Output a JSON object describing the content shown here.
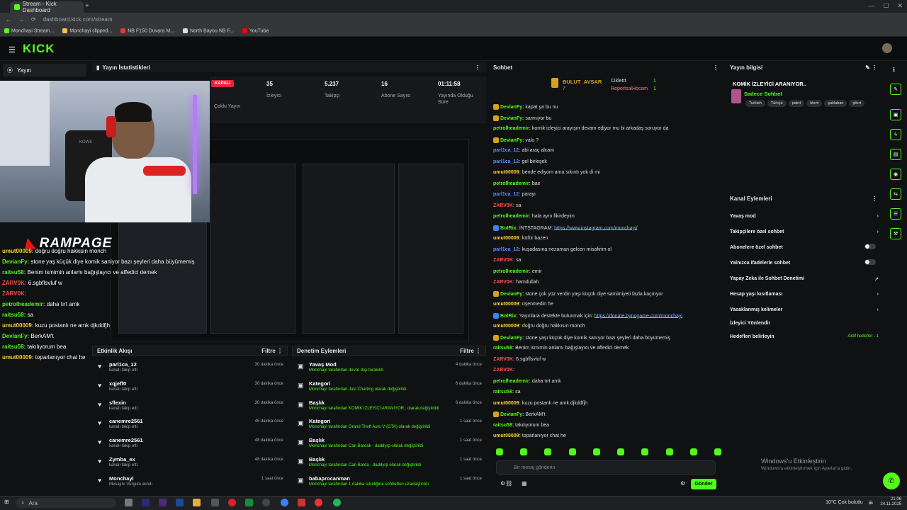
{
  "browser": {
    "tab_title": "Stream - Kick Dashboard",
    "url": "dashboard.kick.com/stream",
    "bookmarks": [
      "Monchayi Stream...",
      "Monchayi clipped...",
      "NB F150 Duvara M...",
      "North Bayou NB F...",
      "YouTube"
    ]
  },
  "brand": {
    "logo": "KICK",
    "accent": "#53fc18"
  },
  "nav": {
    "home": "Yayın"
  },
  "overlay": {
    "sponsor": "RAMPAGE",
    "chat": [
      {
        "user": "umut00009:",
        "text": " doğru doğru hakkisin monch"
      },
      {
        "user": "DevianFy:",
        "text": " stone yaş küçük diye komik saniyor bazı şeyleri daha büyümemiş"
      },
      {
        "user": "raitsu58:",
        "text": " Benim ismimin anlamı bağışlayıcı ve affedici demek"
      },
      {
        "user": "ZARV0K:",
        "text": " 6.sgbflsvluf w"
      },
      {
        "user": "ZARV0K:",
        "text": ""
      },
      {
        "user": "petrolheademir:",
        "text": " daha tırt amk"
      },
      {
        "user": "raitsu58:",
        "text": " sa"
      },
      {
        "user": "umut00009:",
        "text": " kuzu postanlı ne amk djkddfjh"
      },
      {
        "user": "DevianFy:",
        "text": " BerkAM't"
      },
      {
        "user": "raitsu58:",
        "text": " takılıyorum bea"
      },
      {
        "user": "umut00009:",
        "text": " toparlanıyor chat he"
      }
    ]
  },
  "stats": {
    "title": "Yayın İstatistikleri",
    "status": "KAPALI",
    "multi": "Çoklu Yayın",
    "viewers": "35",
    "viewers_label": "İzleyici",
    "followers": "5.237",
    "followers_label": "Takipçi",
    "subs": "16",
    "subs_label": "Abone Sayısı",
    "uptime": "01:11:58",
    "uptime_label": "Yayında Olduğu Süre"
  },
  "activity": {
    "title": "Etkinlik Akışı",
    "filter": "Filtre",
    "rows": [
      {
        "name": "parl1ca_12",
        "sub": "kanalı takip etti",
        "time": "30 dakika önce"
      },
      {
        "name": "xqjeff0",
        "sub": "kanalı takip etti",
        "time": "30 dakika önce"
      },
      {
        "name": "sflexin",
        "sub": "kanalı takip etti",
        "time": "30 dakika önce"
      },
      {
        "name": "canemre2561",
        "sub": "kanalı takip etti",
        "time": "45 dakika önce"
      },
      {
        "name": "canemre2561",
        "sub": "kanalı takip etti",
        "time": "48 dakika önce"
      },
      {
        "name": "Zymba_ex",
        "sub": "kanalı takip etti",
        "time": "48 dakika önce"
      },
      {
        "name": "Monchayi",
        "sub": "Mesajını Vurgula alındı",
        "time": "1 saat önce"
      }
    ]
  },
  "moderation": {
    "title": "Denetim Eylemleri",
    "filter": "Filtre",
    "rows": [
      {
        "name": "Yavaş Mod",
        "sub": "Monchayi tarafından devre dışı bırakıldı",
        "time": "4 dakika önce"
      },
      {
        "name": "Kategori",
        "sub": "Monchayi tarafından Just Chatting olarak değiştirildi",
        "time": "6 dakika önce"
      },
      {
        "name": "Başlık",
        "sub": "Monchayi tarafından KOMİK İZLEYİCİ ARANIYOR.. olarak değiştirildi",
        "time": "6 dakika önce"
      },
      {
        "name": "Kategori",
        "sub": "Monchayi tarafından Grand Theft Auto V (GTA) olarak değiştirildi",
        "time": "1 saat önce"
      },
      {
        "name": "Başlık",
        "sub": "Monchayi tarafından Can Bardak - daddyrp olarak değiştirildi",
        "time": "1 saat önce"
      },
      {
        "name": "Başlık",
        "sub": "Monchayi tarafından Can Barda - daddyrp olarak değiştirildi",
        "time": "1 saat önce"
      },
      {
        "name": "babaprocanman",
        "sub": "Monchayi tarafından 1 dakika süreliğine sohbetten uzaklaştırıldı",
        "time": "1 saat önce"
      }
    ]
  },
  "chat": {
    "title": "Sohbet",
    "placeholder": "Bir mesaj gönderin",
    "send": "Gönder",
    "pinned": [
      {
        "user": "BULUT_AVSAR",
        "n": "7"
      },
      {
        "user": "Ciklettt",
        "n": "1"
      },
      {
        "user": "ReportsalHocam",
        "n": "1"
      }
    ],
    "messages": [
      {
        "user": "DevianFy:",
        "text": "kapat ya bu nu",
        "color": "#53fc18",
        "badge": true
      },
      {
        "user": "DevianFy:",
        "text": "sarmıyor bu",
        "color": "#53fc18",
        "badge": true
      },
      {
        "user": "petrolheademir:",
        "text": "komik izleyici arayışın devam ediyor mu bi arkadaş soruyor da",
        "color": "#53fc18"
      },
      {
        "user": "DevianFy:",
        "text": "valo ?",
        "color": "#53fc18",
        "badge": true
      },
      {
        "user": "parl1ca_12:",
        "text": "abi araç alcam",
        "color": "#5b8cff"
      },
      {
        "user": "parl1ca_12:",
        "text": "gel birleşek",
        "color": "#5b8cff"
      },
      {
        "user": "umut00009:",
        "text": "bende ediyom ama sıkıntı yok di mi",
        "color": "#ffd23f"
      },
      {
        "user": "petrolheademir:",
        "text": "bae",
        "color": "#53fc18"
      },
      {
        "user": "parl1ca_12:",
        "text": "parayı",
        "color": "#5b8cff"
      },
      {
        "user": "ZARV0K:",
        "text": "sa",
        "color": "#ff4d4d"
      },
      {
        "user": "petrolheademir:",
        "text": "hala aynı fikirdeyim",
        "color": "#53fc18"
      },
      {
        "user": "BotRix:",
        "text": "İNTSTAGRAM: ",
        "link": "https://www.instagram.com/monchayi/",
        "color": "#53fc18",
        "bot": true
      },
      {
        "user": "umut00009:",
        "text": "küfür bazen",
        "color": "#ffd23f"
      },
      {
        "user": "parl1ca_12:",
        "text": "kuşadasına nezaman gelcen misafirim ol",
        "color": "#5b8cff"
      },
      {
        "user": "ZARV0K:",
        "text": "sa",
        "color": "#ff4d4d"
      },
      {
        "user": "petrolheademir:",
        "text": "emir",
        "color": "#53fc18"
      },
      {
        "user": "ZARV0K:",
        "text": "hamdullah",
        "color": "#ff4d4d"
      },
      {
        "user": "DevianFy:",
        "text": "stone çok yüz verdin yaşı küçük diye samimiyeti fazla kaçırıyor",
        "color": "#53fc18",
        "badge": true
      },
      {
        "user": "umut00009:",
        "text": "üşenmedin he",
        "color": "#ffd23f"
      },
      {
        "user": "BotRix:",
        "text": "Yayınlara destekte bulunmak için: ",
        "link": "https://donate.bynogame.com/monchayi",
        "color": "#53fc18",
        "bot": true
      },
      {
        "user": "umut00009:",
        "text": "doğru doğru hakkısın monch",
        "color": "#ffd23f"
      },
      {
        "user": "DevianFy:",
        "text": "stone yaşı küçük diye komik sanıyor bazı şeyleri daha büyümemiş",
        "color": "#53fc18",
        "badge": true
      },
      {
        "user": "raitsu58:",
        "text": "Benim ismimin anlamı bağışlayıcı ve affedici demek",
        "color": "#53fc18"
      },
      {
        "user": "ZARV0K:",
        "text": "6.sgbflsvluf w",
        "color": "#ff4d4d"
      },
      {
        "user": "ZARV0K:",
        "text": "",
        "color": "#ff4d4d"
      },
      {
        "user": "petrolheademir:",
        "text": "daha tırt amk",
        "color": "#53fc18"
      },
      {
        "user": "raitsu58:",
        "text": "sa",
        "color": "#53fc18"
      },
      {
        "user": "umut00009:",
        "text": "kuzu postanlı ne amk djkddfjh",
        "color": "#ffd23f"
      },
      {
        "user": "DevianFy:",
        "text": "BerkAM't",
        "color": "#53fc18",
        "badge": true
      },
      {
        "user": "raitsu58:",
        "text": "takılıyorum bea",
        "color": "#53fc18"
      },
      {
        "user": "umut00009:",
        "text": "toparlanıyor chat he",
        "color": "#ffd23f"
      }
    ]
  },
  "info": {
    "title": "Yayın bilgisi",
    "stream_title": "KOMİK İZLEYİCİ ARANIYOR..",
    "category": "Sadece Sohbet",
    "tags": [
      "Turkish",
      "Türkçe",
      "patrıt",
      "tıkırtı",
      "şaklaban",
      "şikırt"
    ]
  },
  "channel": {
    "title": "Kanal Eylemleri",
    "items": [
      {
        "label": "Yavaş mod",
        "kind": "chev"
      },
      {
        "label": "Takipçilere özel sohbet",
        "kind": "chev"
      },
      {
        "label": "Abonelere özel sohbet",
        "kind": "toggle"
      },
      {
        "label": "Yalnızca ifadelerle sohbet",
        "kind": "toggle"
      },
      {
        "label": "Yapay Zeka ile Sohbet Denetimi",
        "kind": "ext"
      },
      {
        "label": "Hesap yaşı kısıtlaması",
        "kind": "chev"
      },
      {
        "label": "Yasaklanmış kelimeler",
        "kind": "chev"
      },
      {
        "label": "İzleyici Yönlendir",
        "kind": "none"
      },
      {
        "label": "Hedefleri belirleyin",
        "kind": "goal",
        "extra": "Aktif hedefler - 1"
      }
    ]
  },
  "windows": {
    "title": "Windows'u Etkinleştirin",
    "sub": "Windows'u etkinleştirmek için Ayarlar'a gidin."
  },
  "taskbar": {
    "search": "Ara",
    "weather": "10°C  Çok bulutlu",
    "time": "21:06",
    "date": "24.11.2025"
  }
}
